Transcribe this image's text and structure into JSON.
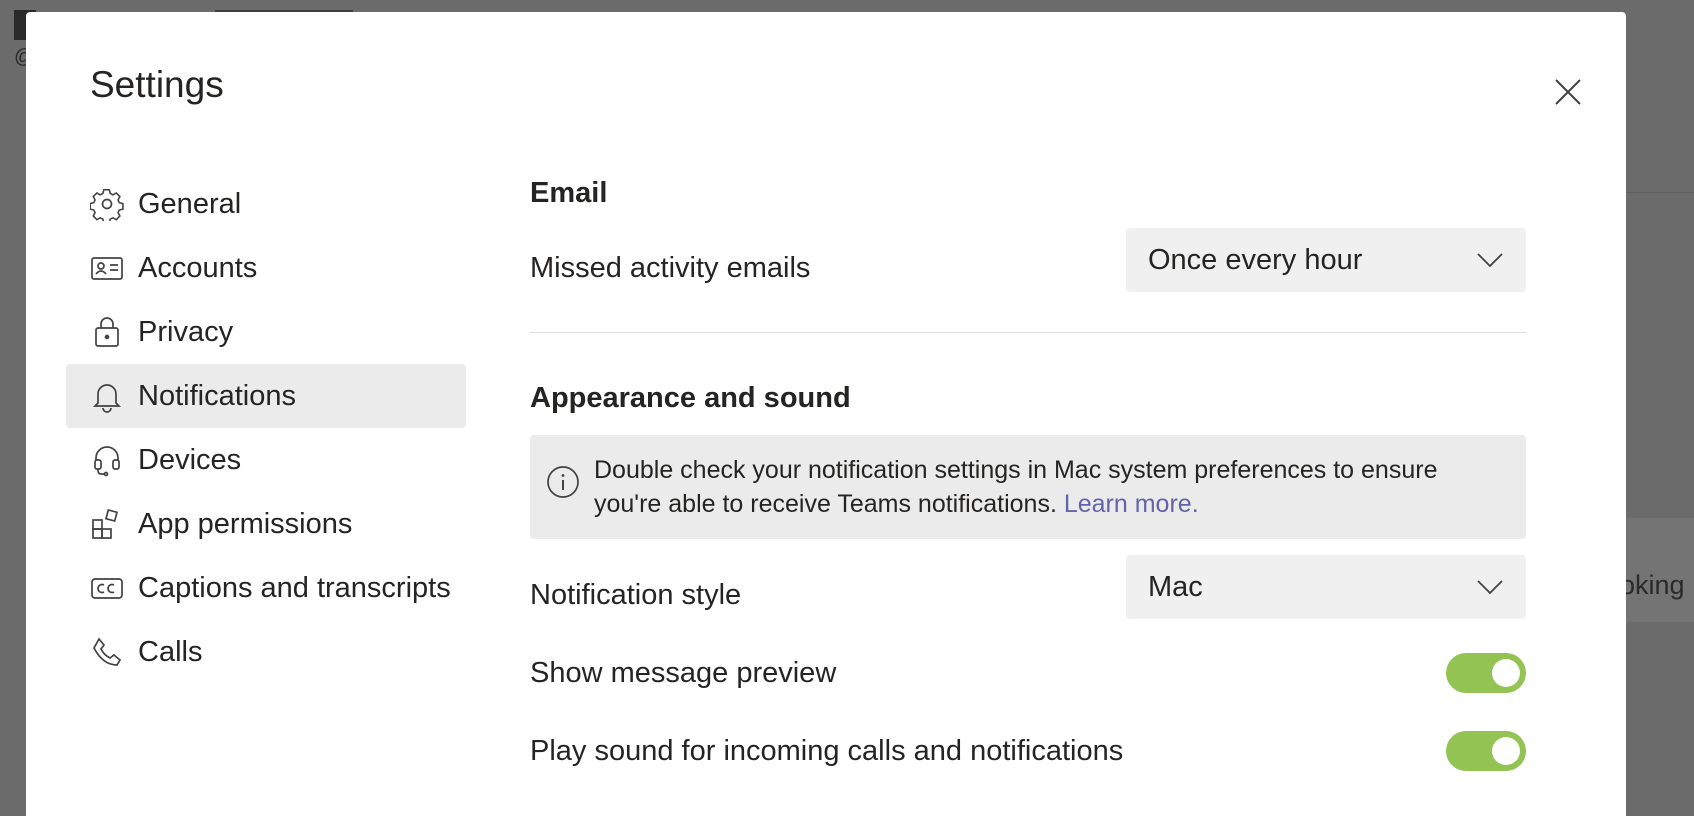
{
  "background": {
    "at_symbol": "@",
    "card_text": "oking"
  },
  "dialog": {
    "title": "Settings"
  },
  "nav": {
    "items": [
      {
        "label": "General",
        "icon": "gear-icon",
        "active": false
      },
      {
        "label": "Accounts",
        "icon": "id-card-icon",
        "active": false
      },
      {
        "label": "Privacy",
        "icon": "lock-icon",
        "active": false
      },
      {
        "label": "Notifications",
        "icon": "bell-icon",
        "active": true
      },
      {
        "label": "Devices",
        "icon": "headset-icon",
        "active": false
      },
      {
        "label": "App permissions",
        "icon": "apps-icon",
        "active": false
      },
      {
        "label": "Captions and transcripts",
        "icon": "cc-icon",
        "active": false
      },
      {
        "label": "Calls",
        "icon": "phone-icon",
        "active": false
      }
    ]
  },
  "email": {
    "section_title": "Email",
    "missed_label": "Missed activity emails",
    "missed_value": "Once every hour"
  },
  "appearance": {
    "section_title": "Appearance and sound",
    "info_text": "Double check your notification settings in Mac system preferences to ensure you're able to receive Teams notifications.",
    "info_link": "Learn more.",
    "style_label": "Notification style",
    "style_value": "Mac",
    "preview_label": "Show message preview",
    "preview_on": true,
    "sound_label": "Play sound for incoming calls and notifications",
    "sound_on": true
  },
  "colors": {
    "accent": "#6264a7",
    "toggle_on": "#92c353",
    "active_nav_bg": "#ebebeb"
  }
}
